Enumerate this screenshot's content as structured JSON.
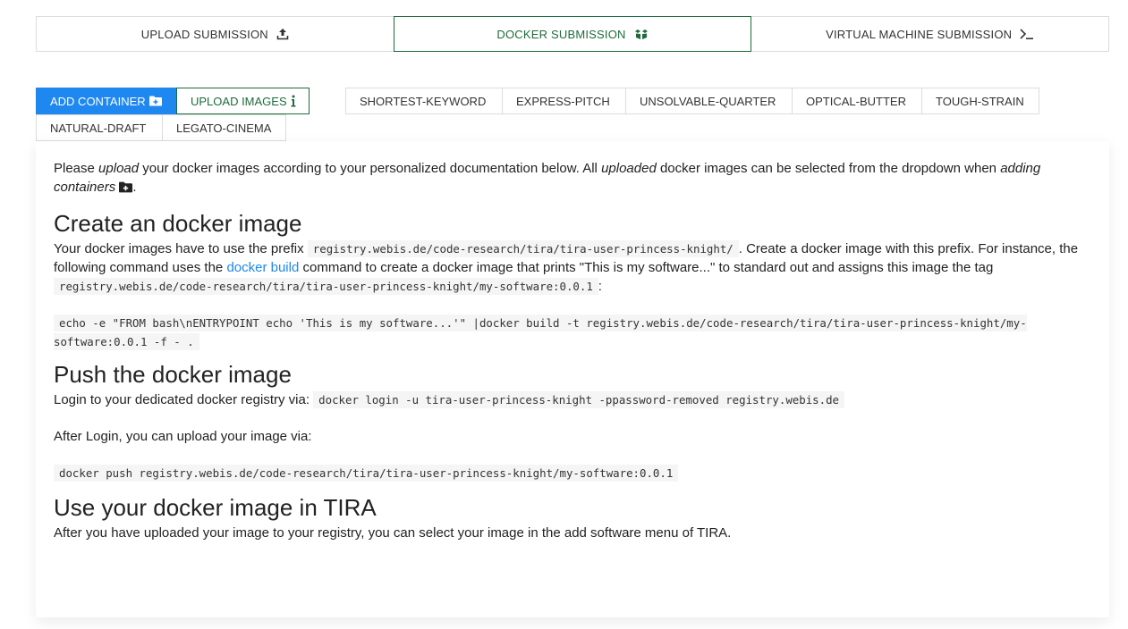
{
  "top_tabs": [
    {
      "label": "UPLOAD SUBMISSION",
      "icon": "upload-icon",
      "active": false
    },
    {
      "label": "DOCKER SUBMISSION",
      "icon": "docker-icon",
      "active": true
    },
    {
      "label": "VIRTUAL MACHINE SUBMISSION",
      "icon": "terminal-icon",
      "active": false
    }
  ],
  "action_buttons": {
    "add_container": "ADD CONTAINER",
    "upload_images": "UPLOAD IMAGES"
  },
  "containers": [
    "SHORTEST-KEYWORD",
    "EXPRESS-PITCH",
    "UNSOLVABLE-QUARTER",
    "OPTICAL-BUTTER",
    "TOUGH-STRAIN",
    "NATURAL-DRAFT",
    "LEGATO-CINEMA"
  ],
  "intro": {
    "t1": "Please ",
    "em1": "upload",
    "t2": " your docker images according to your personalized documentation below. All ",
    "em2": "uploaded",
    "t3": " docker images can be selected from the dropdown when ",
    "em3": "adding containers",
    "t4": "."
  },
  "create": {
    "heading": "Create an docker image",
    "t1": "Your docker images have to use the prefix ",
    "prefix": "registry.webis.de/code-research/tira/tira-user-princess-knight/",
    "t2": ". Create a docker image with this prefix. For instance, the following command uses the ",
    "link": "docker build",
    "t3": " command to create a docker image that prints \"This is my software...\" to standard out and assigns this image the tag ",
    "tag": "registry.webis.de/code-research/tira/tira-user-princess-knight/my-software:0.0.1",
    "t4": ":",
    "cmd_line1": "echo -e \"FROM bash\\nENTRYPOINT echo 'This is my software...'\" |docker build -t registry.webis.de/code-research/tira/tira-user-princess-knight/my-",
    "cmd_line2": "software:0.0.1 -f - ."
  },
  "push": {
    "heading": "Push the docker image",
    "t1": "Login to your dedicated docker registry via: ",
    "login_cmd": "docker login -u tira-user-princess-knight -ppassword-removed registry.webis.de",
    "t2": "After Login, you can upload your image via:",
    "push_cmd": "docker push registry.webis.de/code-research/tira/tira-user-princess-knight/my-software:0.0.1"
  },
  "use": {
    "heading": "Use your docker image in TIRA",
    "t1": "After you have uploaded your image to your registry, you can select your image in the add software menu of TIRA."
  },
  "colors": {
    "primary": "#1e87f0",
    "success": "#1e6b3c",
    "border": "#dcdcdc"
  }
}
